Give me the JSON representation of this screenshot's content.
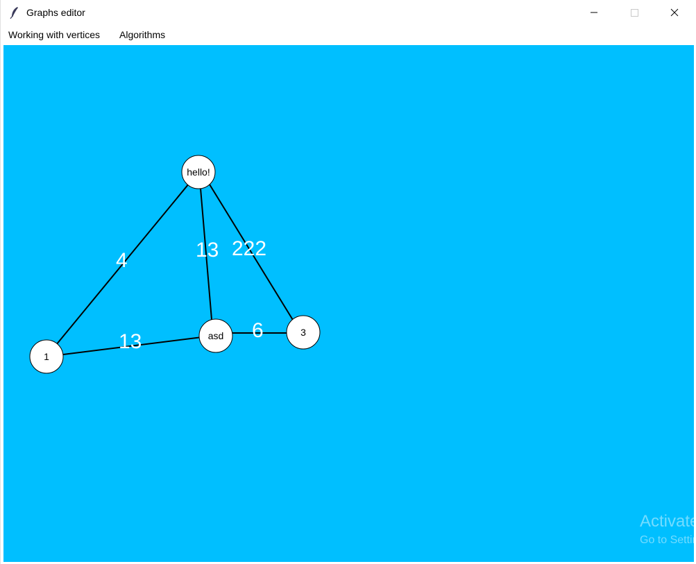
{
  "window": {
    "title": "Graphs editor",
    "app_icon": "feather-icon",
    "controls": [
      "minimize-icon",
      "maximize-icon",
      "close-icon"
    ]
  },
  "menubar": {
    "items": [
      {
        "label": "Working with vertices"
      },
      {
        "label": "Algorithms"
      }
    ]
  },
  "canvas": {
    "background": "#00bfff",
    "vertices": [
      {
        "id": "hello",
        "label": "hello!"
      },
      {
        "id": "v1",
        "label": "1"
      },
      {
        "id": "asd",
        "label": "asd"
      },
      {
        "id": "v3",
        "label": "3"
      }
    ],
    "edges": [
      {
        "from": "hello",
        "to": "v1",
        "weight": "4"
      },
      {
        "from": "hello",
        "to": "asd",
        "weight": "13"
      },
      {
        "from": "hello",
        "to": "v3",
        "weight": "222"
      },
      {
        "from": "v1",
        "to": "asd",
        "weight": "13"
      },
      {
        "from": "asd",
        "to": "v3",
        "weight": "6"
      }
    ]
  },
  "watermark": {
    "line1": "Activate",
    "line2": "Go to Settings"
  }
}
